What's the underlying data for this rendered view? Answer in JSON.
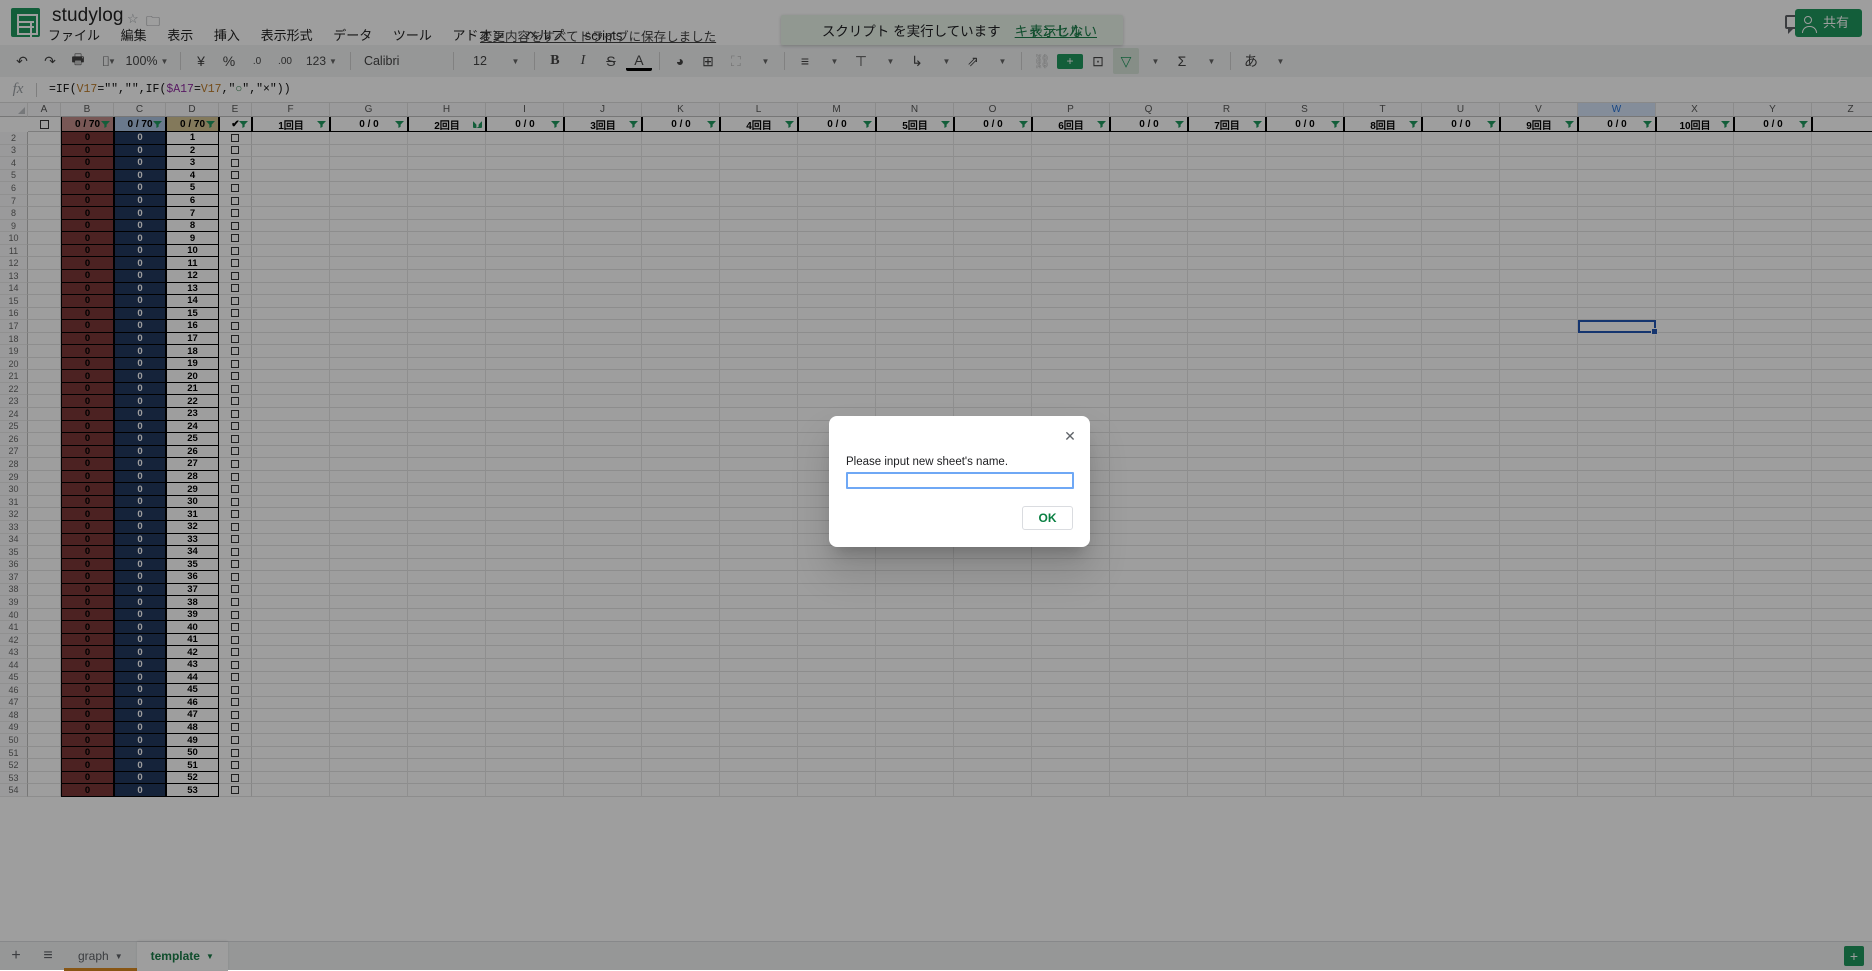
{
  "header": {
    "doc_title": "studylog",
    "star_icon": "star-icon",
    "folder_icon": "folder-icon",
    "save_state": "変更内容をすべてドライブに保存しました",
    "share_label": "共有",
    "menus": [
      "ファイル",
      "編集",
      "表示",
      "挿入",
      "表示形式",
      "データ",
      "ツール",
      "アドオン",
      "ヘルプ",
      "scripts"
    ]
  },
  "toast": {
    "message": "スクリプト を実行しています",
    "cancel_label": "キャンセル",
    "dismiss_label": "表示しない",
    "bg_color": "#e8f5e9",
    "link_color": "#0b8043"
  },
  "toolbar": {
    "undo": "↶",
    "redo": "↷",
    "print": "🖶",
    "paint": "⌷",
    "zoom_value": "100%",
    "currency": "¥",
    "percent": "%",
    "dec_decrease": ".0",
    "dec_increase": ".00",
    "number_format": "123",
    "font_family_value": "Calibri",
    "font_size_value": "12",
    "bold": "B",
    "italic": "I",
    "strikethrough": "S",
    "text_color": "A",
    "fill_color": "◕",
    "borders": "⊞",
    "merge": "⛶",
    "halign": "≡",
    "valign": "⊤",
    "wrap": "↳",
    "rotate": "⇗",
    "link": "⛓",
    "comment": "+",
    "chart": "⊡",
    "filter": "▽",
    "functions": "Σ",
    "ime": "あ"
  },
  "formula_bar": {
    "fx_icon": "fx-icon",
    "formula_parts": [
      {
        "t": "=IF(",
        "c": "plain"
      },
      {
        "t": "V17",
        "c": "ref1"
      },
      {
        "t": "=\"\",\"\",IF(",
        "c": "plain"
      },
      {
        "t": "$A17",
        "c": "ref2"
      },
      {
        "t": "=",
        "c": "plain"
      },
      {
        "t": "V17",
        "c": "ref1"
      },
      {
        "t": ",\"",
        "c": "plain"
      },
      {
        "t": "○",
        "c": "green"
      },
      {
        "t": "\",\"×\"))",
        "c": "plain"
      }
    ],
    "formula_text": "=IF(V17=\"\",\"\",IF($A17=V17,\"○\",\"×\"))"
  },
  "grid": {
    "selected_cell": "W17",
    "selected_column": "W",
    "columns": [
      "A",
      "B",
      "C",
      "D",
      "E",
      "F",
      "G",
      "H",
      "I",
      "J",
      "K",
      "L",
      "M",
      "N",
      "O",
      "P",
      "Q",
      "R",
      "S",
      "T",
      "U",
      "V",
      "W",
      "X",
      "Y",
      "Z"
    ],
    "row1": [
      {
        "col": "A",
        "value": "",
        "type": "checkbox-cell"
      },
      {
        "col": "B",
        "value": "0 / 70",
        "type": "counter",
        "bg": "#c98a87",
        "filter": true
      },
      {
        "col": "C",
        "value": "0 / 70",
        "type": "counter",
        "bg": "#a8c4e8",
        "filter": true
      },
      {
        "col": "D",
        "value": "0 / 70",
        "type": "counter",
        "bg": "#d6c48a",
        "filter": true
      },
      {
        "col": "E",
        "value": "✔",
        "type": "check",
        "bg": "#ffffff",
        "filter": true
      },
      {
        "col": "F",
        "value": "1回目",
        "type": "label",
        "bg": "#ffffff",
        "filter": true
      },
      {
        "col": "G",
        "value": "0 / 0",
        "type": "counter",
        "bg": "#ffffff",
        "filter": true
      },
      {
        "col": "H",
        "value": "2回目",
        "type": "label",
        "bg": "#ffffff",
        "filter": true,
        "filter_active": true
      },
      {
        "col": "I",
        "value": "0 / 0",
        "type": "counter",
        "bg": "#ffffff",
        "filter": true
      },
      {
        "col": "J",
        "value": "3回目",
        "type": "label",
        "bg": "#ffffff",
        "filter": true
      },
      {
        "col": "K",
        "value": "0 / 0",
        "type": "counter",
        "bg": "#ffffff",
        "filter": true
      },
      {
        "col": "L",
        "value": "4回目",
        "type": "label",
        "bg": "#ffffff",
        "filter": true
      },
      {
        "col": "M",
        "value": "0 / 0",
        "type": "counter",
        "bg": "#ffffff",
        "filter": true
      },
      {
        "col": "N",
        "value": "5回目",
        "type": "label",
        "bg": "#ffffff",
        "filter": true
      },
      {
        "col": "O",
        "value": "0 / 0",
        "type": "counter",
        "bg": "#ffffff",
        "filter": true
      },
      {
        "col": "P",
        "value": "6回目",
        "type": "label",
        "bg": "#ffffff",
        "filter": true
      },
      {
        "col": "Q",
        "value": "0 / 0",
        "type": "counter",
        "bg": "#ffffff",
        "filter": true
      },
      {
        "col": "R",
        "value": "7回目",
        "type": "label",
        "bg": "#ffffff",
        "filter": true
      },
      {
        "col": "S",
        "value": "0 / 0",
        "type": "counter",
        "bg": "#ffffff",
        "filter": true
      },
      {
        "col": "T",
        "value": "8回目",
        "type": "label",
        "bg": "#ffffff",
        "filter": true
      },
      {
        "col": "U",
        "value": "0 / 0",
        "type": "counter",
        "bg": "#ffffff",
        "filter": true
      },
      {
        "col": "V",
        "value": "9回目",
        "type": "label",
        "bg": "#ffffff",
        "filter": true
      },
      {
        "col": "W",
        "value": "0 / 0",
        "type": "counter",
        "bg": "#ffffff",
        "filter": true
      },
      {
        "col": "X",
        "value": "10回目",
        "type": "label",
        "bg": "#ffffff",
        "filter": true
      },
      {
        "col": "Y",
        "value": "0 / 0",
        "type": "counter",
        "bg": "#ffffff",
        "filter": true
      },
      {
        "col": "Z",
        "value": "",
        "type": "blank",
        "bg": "#ffffff",
        "filter": true
      }
    ],
    "data_rows_start": 2,
    "data_rows_end": 54,
    "col_b_value": "0",
    "col_c_value": "0",
    "col_b_bg": "#843534",
    "col_c_bg": "#1f3864",
    "col_d_start": 1
  },
  "sheet_tabs": {
    "add_label": "+",
    "all_sheets_label": "≡",
    "tabs": [
      {
        "name": "graph",
        "active": false,
        "underline": "#e8890c"
      },
      {
        "name": "template",
        "active": true,
        "underline": "#ffffff"
      }
    ]
  },
  "modal": {
    "close_icon": "close-icon",
    "label": "Please input new sheet's name.",
    "input_value": "",
    "input_placeholder": "",
    "ok_label": "OK",
    "ok_color": "#0b8043"
  }
}
